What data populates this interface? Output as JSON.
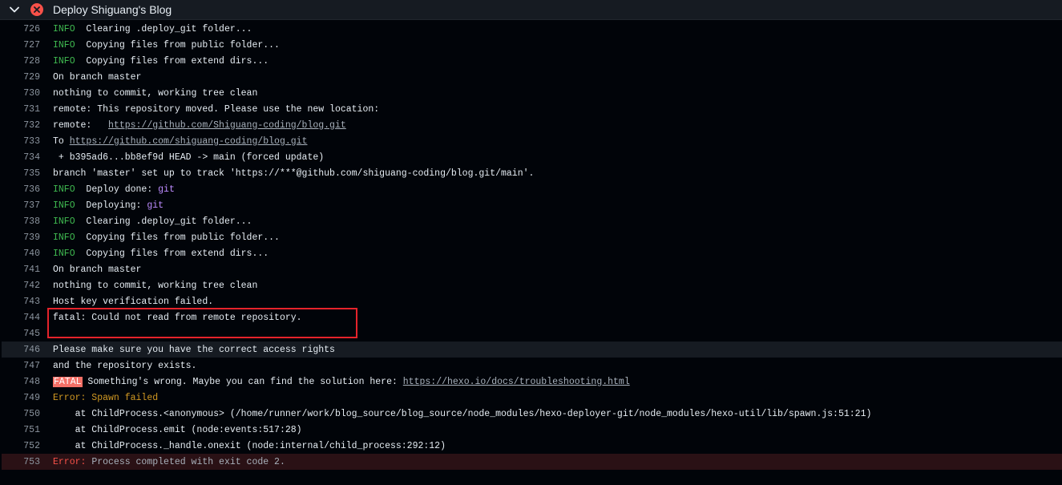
{
  "step": {
    "title": "Deploy Shiguang's Blog",
    "status": "failed"
  },
  "colors": {
    "info": "#3fb950",
    "git": "#bc8cff",
    "error_label": "#d29922",
    "fatal_badge": "#f47067",
    "annotation": "#e5232b"
  },
  "lines": [
    {
      "n": "726",
      "tag": "INFO",
      "text": "Clearing .deploy_git folder..."
    },
    {
      "n": "727",
      "tag": "INFO",
      "text": "Copying files from public folder..."
    },
    {
      "n": "728",
      "tag": "INFO",
      "text": "Copying files from extend dirs..."
    },
    {
      "n": "729",
      "text": "On branch master"
    },
    {
      "n": "730",
      "text": "nothing to commit, working tree clean"
    },
    {
      "n": "731",
      "text": "remote: This repository moved. Please use the new location:"
    },
    {
      "n": "732",
      "text": "remote:   ",
      "link": "https://github.com/Shiguang-coding/blog.git"
    },
    {
      "n": "733",
      "text": "To ",
      "link": "https://github.com/shiguang-coding/blog.git"
    },
    {
      "n": "734",
      "text": " + b395ad6...bb8ef9d HEAD -> main (forced update)"
    },
    {
      "n": "735",
      "text": "branch 'master' set up to track 'https://***@github.com/shiguang-coding/blog.git/main'."
    },
    {
      "n": "736",
      "tag": "INFO",
      "text": "Deploy done: ",
      "accent": "git"
    },
    {
      "n": "737",
      "tag": "INFO",
      "text": "Deploying: ",
      "accent": "git"
    },
    {
      "n": "738",
      "tag": "INFO",
      "text": "Clearing .deploy_git folder..."
    },
    {
      "n": "739",
      "tag": "INFO",
      "text": "Copying files from public folder..."
    },
    {
      "n": "740",
      "tag": "INFO",
      "text": "Copying files from extend dirs..."
    },
    {
      "n": "741",
      "text": "On branch master"
    },
    {
      "n": "742",
      "text": "nothing to commit, working tree clean"
    },
    {
      "n": "743",
      "text": "Host key verification failed."
    },
    {
      "n": "744",
      "text": "fatal: Could not read from remote repository."
    },
    {
      "n": "745",
      "text": ""
    },
    {
      "n": "746",
      "text": "Please make sure you have the correct access rights"
    },
    {
      "n": "747",
      "text": "and the repository exists."
    },
    {
      "n": "748",
      "badge": "FATAL",
      "text": " Something's wrong. Maybe you can find the solution here: ",
      "link": "https://hexo.io/docs/troubleshooting.html"
    },
    {
      "n": "749",
      "orange": "Error: Spawn failed"
    },
    {
      "n": "750",
      "text": "    at ChildProcess.<anonymous> (/home/runner/work/blog_source/blog_source/node_modules/hexo-deployer-git/node_modules/hexo-util/lib/spawn.js:51:21)"
    },
    {
      "n": "751",
      "text": "    at ChildProcess.emit (node:events:517:28)"
    },
    {
      "n": "752",
      "text": "    at ChildProcess._handle.onexit (node:internal/child_process:292:12)"
    },
    {
      "n": "753",
      "error": "Error:",
      "muted": " Process completed with exit code 2."
    }
  ]
}
